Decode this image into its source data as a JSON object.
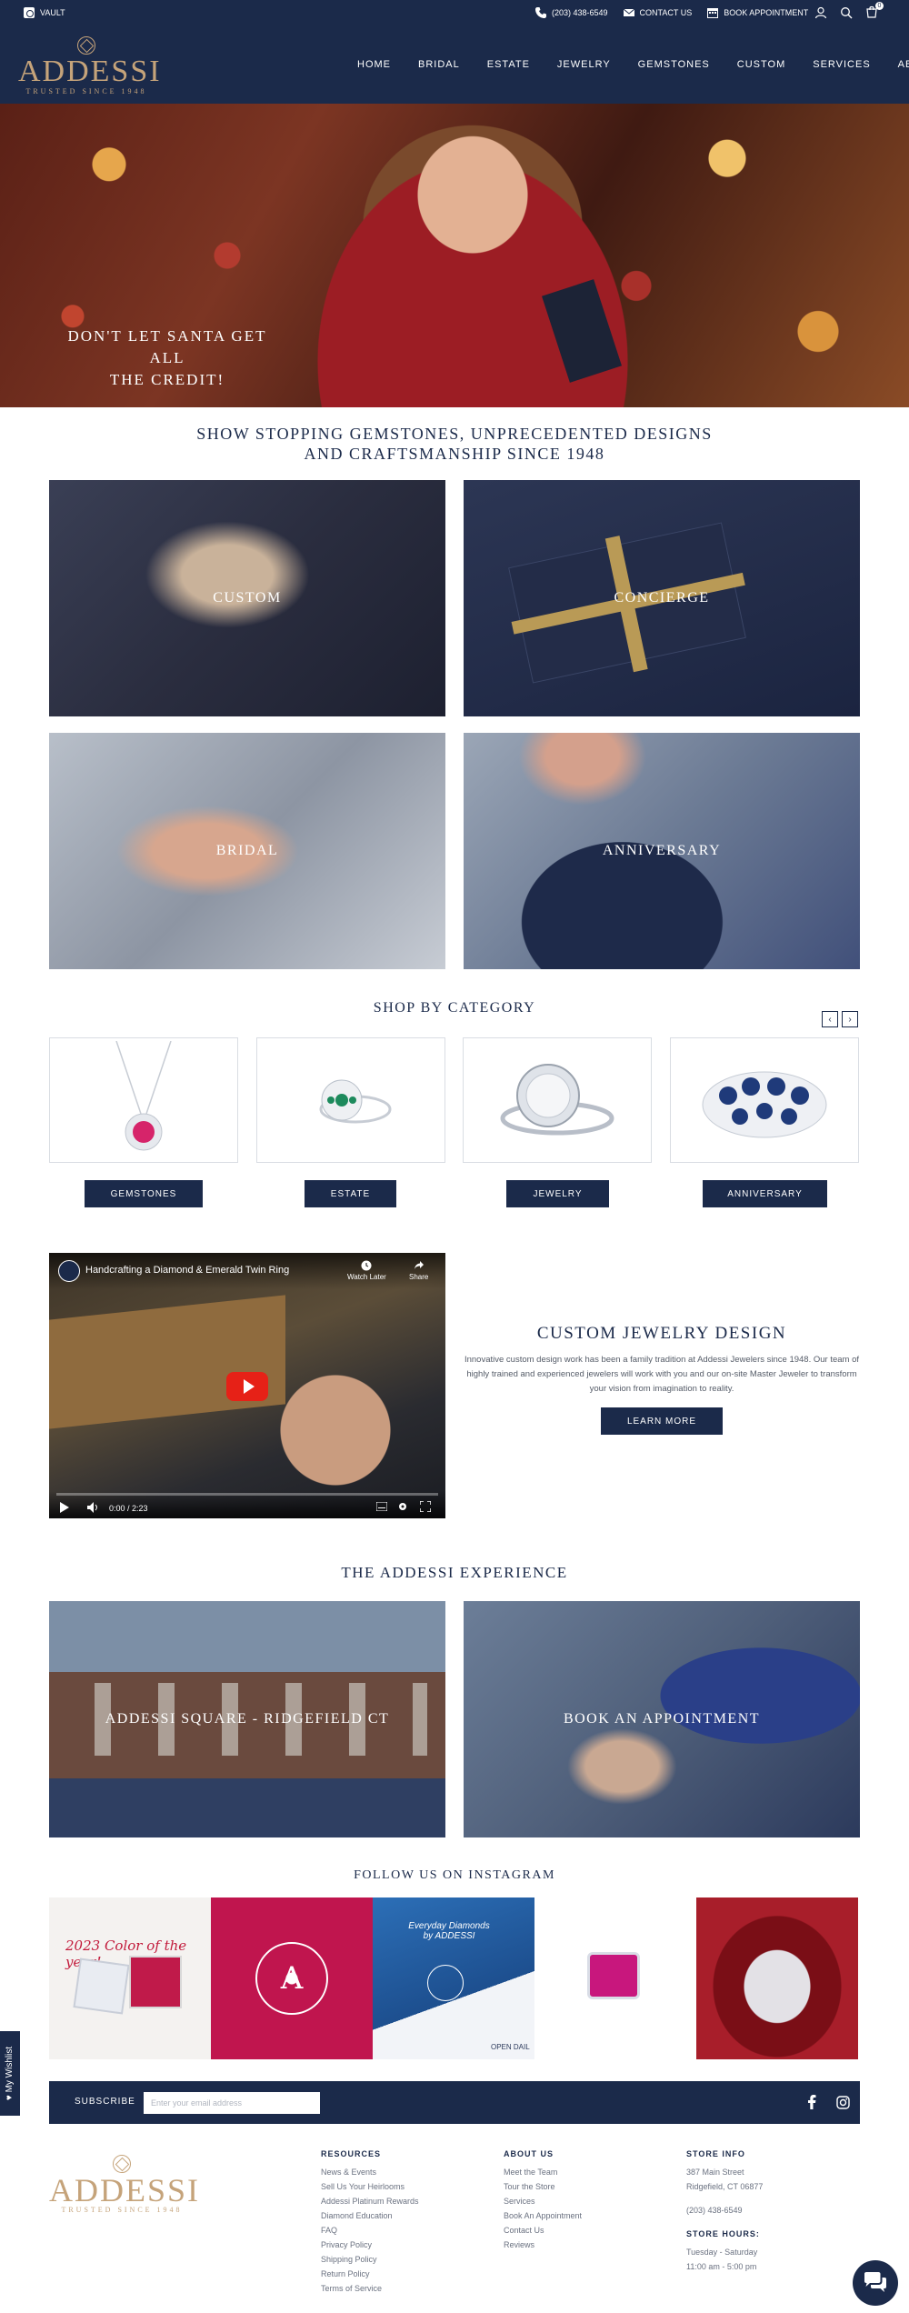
{
  "topbar": {
    "vault": "VAULT",
    "phone": "(203) 438-6549",
    "contact": "CONTACT US",
    "book": "BOOK APPOINTMENT",
    "cart_count": "0"
  },
  "brand": {
    "name": "ADDESSI",
    "tagline": "TRUSTED SINCE 1948",
    "color": "#c5a37a",
    "navy": "#1b2a4a"
  },
  "nav": [
    "HOME",
    "BRIDAL",
    "ESTATE",
    "JEWELRY",
    "GEMSTONES",
    "CUSTOM",
    "SERVICES",
    "ABOUT"
  ],
  "hero": {
    "text_line1": "DON'T LET SANTA GET ALL",
    "text_line2": "THE CREDIT!",
    "slides": 4,
    "active_slide": 1
  },
  "tagline": {
    "line1": "SHOW STOPPING GEMSTONES, UNPRECEDENTED DESIGNS",
    "line2": "AND CRAFTSMANSHIP SINCE 1948"
  },
  "tiles": {
    "custom": "CUSTOM",
    "concierge": "CONCIERGE",
    "bridal": "BRIDAL",
    "anniversary": "ANNIVERSARY"
  },
  "shop": {
    "title": "SHOP BY CATEGORY",
    "prev": "‹",
    "next": "›",
    "categories": [
      "GEMSTONES",
      "ESTATE",
      "JEWELRY",
      "ANNIVERSARY"
    ]
  },
  "video": {
    "title": "Handcrafting a Diamond & Emerald Twin Ring",
    "watch_later": "Watch Later",
    "share": "Share",
    "time": "0:00 / 2:23"
  },
  "custom_design": {
    "title": "CUSTOM JEWELRY DESIGN",
    "text": "Innovative custom design work has been a family tradition at Addessi Jewelers since 1948. Our team of highly trained and experienced jewelers will work with you and our on-site Master Jeweler to transform your vision from imagination to reality.",
    "button": "LEARN MORE"
  },
  "experience": {
    "title": "THE ADDESSI EXPERIENCE",
    "square": "ADDESSI SQUARE - RIDGEFIELD CT",
    "book": "BOOK AN APPOINTMENT"
  },
  "instagram": {
    "title": "FOLLOW US ON INSTAGRAM",
    "post1_text": "2023 Color of the year!",
    "post2_letter": "A",
    "post3_line1": "Everyday Diamonds",
    "post3_line2": "by ADDESSI",
    "post3_open": "OPEN DAIL"
  },
  "subscribe": {
    "label": "SUBSCRIBE",
    "placeholder": "Enter your email address"
  },
  "footer": {
    "resources": {
      "title": "RESOURCES",
      "links": [
        "News & Events",
        "Sell Us Your Heirlooms",
        "Addessi Platinum Rewards",
        "Diamond Education",
        "FAQ",
        "Privacy Policy",
        "Shipping Policy",
        "Return Policy",
        "Terms of Service"
      ]
    },
    "about": {
      "title": "ABOUT US",
      "links": [
        "Meet the Team",
        "Tour the Store",
        "Services",
        "Book An Appointment",
        "Contact Us",
        "Reviews"
      ]
    },
    "store": {
      "title": "STORE INFO",
      "address1": "387 Main Street",
      "address2": "Ridgefield, CT 06877",
      "phone": "(203) 438-6549",
      "hours_title": "STORE HOURS:",
      "days": "Tuesday - Saturday",
      "hours": "11:00 am - 5:00 pm"
    }
  },
  "wishlist": "My Wishlist"
}
